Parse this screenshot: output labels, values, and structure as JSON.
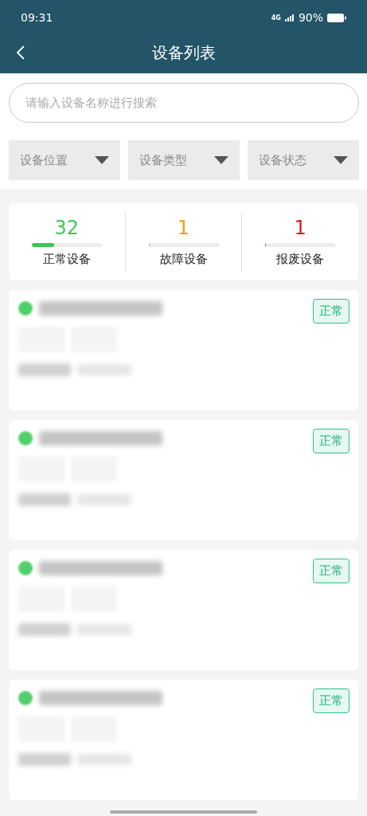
{
  "status_bar": {
    "time": "09:31",
    "network": "4G",
    "battery": "90%"
  },
  "header": {
    "title": "设备列表"
  },
  "search": {
    "placeholder": "请输入设备名称进行搜索"
  },
  "filters": [
    {
      "label": "设备位置"
    },
    {
      "label": "设备类型"
    },
    {
      "label": "设备状态"
    }
  ],
  "stats": [
    {
      "count": "32",
      "label": "正常设备",
      "level": 0.32,
      "color": "#3cc55a"
    },
    {
      "count": "1",
      "label": "故障设备",
      "level": 0.01,
      "color": "#f0a020"
    },
    {
      "count": "1",
      "label": "报废设备",
      "level": 0.01,
      "color": "#e0141e"
    }
  ],
  "devices": [
    {
      "status": "正常",
      "color": "#4fd06a"
    },
    {
      "status": "正常",
      "color": "#4fd06a"
    },
    {
      "status": "正常",
      "color": "#4fd06a"
    },
    {
      "status": "正常",
      "color": "#4fd06a"
    }
  ]
}
